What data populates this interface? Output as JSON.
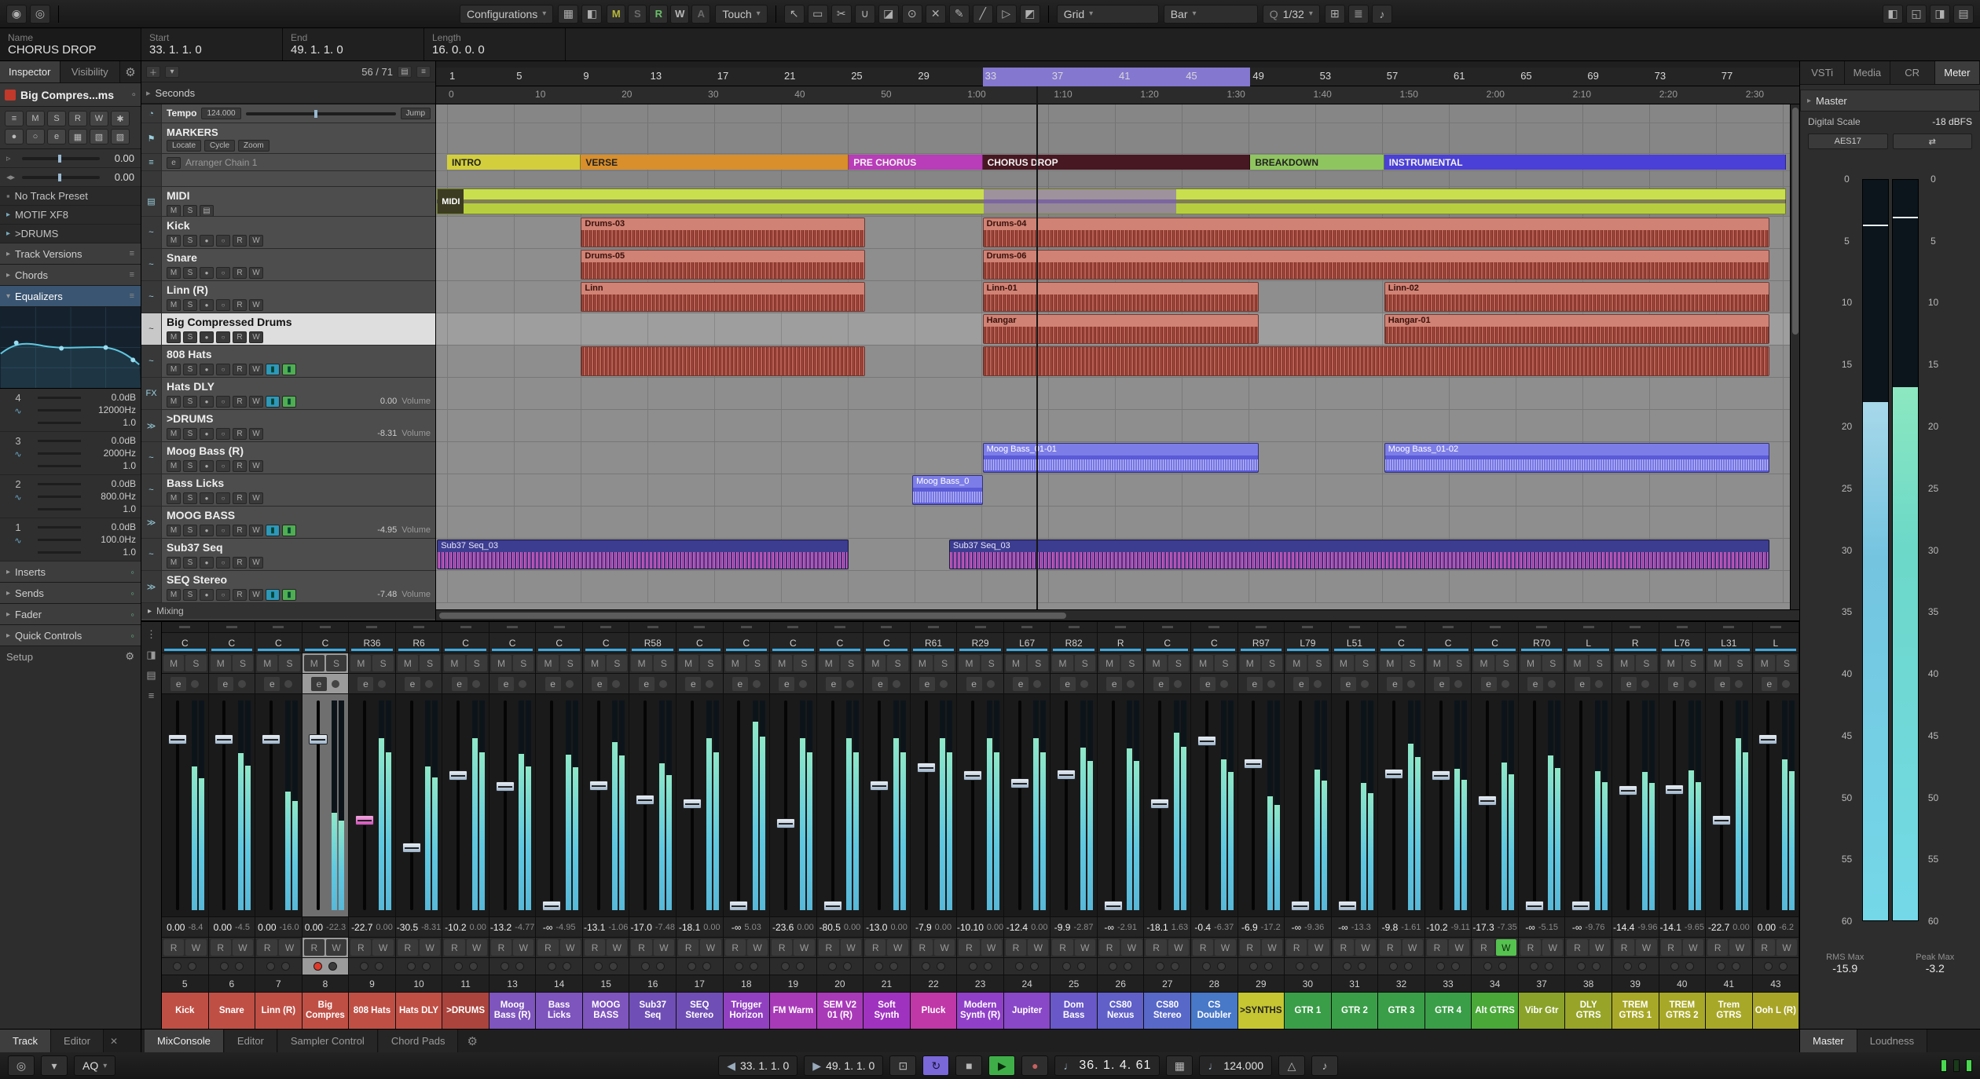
{
  "toolbar": {
    "configurations": "Configurations",
    "automation": [
      "M",
      "S",
      "R",
      "W",
      "A"
    ],
    "automation_colors": [
      "#b8b83a",
      "#6a6a6a",
      "#6abf69",
      "#b8b8b8",
      "#6a6a6a"
    ],
    "tool_mode": "Touch",
    "grid_mode": "Grid",
    "grid_type": "Bar",
    "quantize_prefix": "Q",
    "quantize": "1/32",
    "left_icons": [
      {
        "name": "activate-project-icon",
        "glyph": "◉"
      },
      {
        "name": "hub-icon",
        "glyph": "◎"
      }
    ],
    "mode_icons": [
      {
        "name": "window-layout-icon",
        "glyph": "▦"
      },
      {
        "name": "snapshot-icon",
        "glyph": "◧"
      }
    ],
    "tool_icons": [
      {
        "name": "pointer-tool-icon",
        "glyph": "↖"
      },
      {
        "name": "range-tool-icon",
        "glyph": "▭"
      },
      {
        "name": "split-tool-icon",
        "glyph": "✂"
      },
      {
        "name": "glue-tool-icon",
        "glyph": "∪"
      },
      {
        "name": "erase-tool-icon",
        "glyph": "◪"
      },
      {
        "name": "zoom-tool-icon",
        "glyph": "⊙"
      },
      {
        "name": "mute-tool-icon",
        "glyph": "✕"
      },
      {
        "name": "draw-tool-icon",
        "glyph": "✎"
      },
      {
        "name": "line-tool-icon",
        "glyph": "╱"
      },
      {
        "name": "play-tool-icon",
        "glyph": "▷"
      },
      {
        "name": "color-tool-icon",
        "glyph": "◩"
      }
    ],
    "right_icons": [
      {
        "name": "snap-icon",
        "glyph": "⊞"
      },
      {
        "name": "quantize-panel-icon",
        "glyph": "≣"
      },
      {
        "name": "midi-input-icon",
        "glyph": "♪"
      }
    ],
    "window_icons": [
      {
        "name": "left-zone-icon",
        "glyph": "◧"
      },
      {
        "name": "lower-zone-icon",
        "glyph": "◱"
      },
      {
        "name": "right-zone-icon",
        "glyph": "◨"
      },
      {
        "name": "setup-toolbar-icon",
        "glyph": "▤"
      }
    ]
  },
  "infobar": {
    "fields": [
      {
        "label": "Name",
        "value": "CHORUS DROP"
      },
      {
        "label": "Start",
        "value": "33. 1. 1. 0"
      },
      {
        "label": "End",
        "value": "49. 1. 1. 0"
      },
      {
        "label": "Length",
        "value": "16. 0. 0. 0"
      }
    ]
  },
  "inspector": {
    "tabs": [
      "Inspector",
      "Visibility"
    ],
    "track_name": "Big Compres...ms",
    "volume": "0.00",
    "pan": "0.00",
    "preset": "No Track Preset",
    "routing": [
      "MOTIF XF8",
      ">DRUMS"
    ],
    "buttons_row1": [
      "≡",
      "M",
      "S",
      "R",
      "W",
      "✱"
    ],
    "buttons_row2": [
      "●",
      "○",
      "e",
      "▦",
      "▧",
      "▨"
    ],
    "sections": [
      "Track Versions",
      "Chords",
      "Equalizers"
    ],
    "eq_bands": [
      {
        "band": "4",
        "gain": "0.0dB",
        "freq": "12000Hz",
        "q": "1.0"
      },
      {
        "band": "3",
        "gain": "0.0dB",
        "freq": "2000Hz",
        "q": "1.0"
      },
      {
        "band": "2",
        "gain": "0.0dB",
        "freq": "800.0Hz",
        "q": "1.0"
      },
      {
        "band": "1",
        "gain": "0.0dB",
        "freq": "100.0Hz",
        "q": "1.0"
      }
    ],
    "lower_sections": [
      "Inserts",
      "Sends",
      "Fader",
      "Quick Controls"
    ],
    "setup": "Setup",
    "bottom_tabs": [
      "Track",
      "Editor"
    ]
  },
  "track_list": {
    "counter": "56 / 71",
    "timebase": "Seconds",
    "tempo_track": {
      "name": "Tempo",
      "value": "124.000",
      "jump": "Jump"
    },
    "marker_track": {
      "name": "MARKERS",
      "buttons": [
        "Locate",
        "Cycle",
        "Zoom"
      ]
    },
    "arranger_track": {
      "name": "Arranger Chain 1"
    },
    "folder_track": {
      "name": "MIDI"
    },
    "mixing_label": "Mixing",
    "button_labels": {
      "mute": "M",
      "solo": "S",
      "edit": "e",
      "read": "R",
      "write": "W"
    },
    "tracks": [
      {
        "name": "Kick",
        "type": "audio"
      },
      {
        "name": "Snare",
        "type": "audio"
      },
      {
        "name": "Linn (R)",
        "type": "audio"
      },
      {
        "name": "Big Compressed Drums",
        "type": "audio",
        "selected": true
      },
      {
        "name": "808 Hats",
        "type": "audio",
        "insert_active": true
      },
      {
        "name": "Hats DLY",
        "type": "fx",
        "insert_active": true,
        "value": "0.00",
        "value_label": "Volume"
      },
      {
        "name": ">DRUMS",
        "type": "group",
        "value": "-8.31",
        "value_label": "Volume"
      },
      {
        "name": "Moog Bass (R)",
        "type": "audio"
      },
      {
        "name": "Bass Licks",
        "type": "audio"
      },
      {
        "name": "MOOG BASS",
        "type": "group",
        "insert_active": true,
        "value": "-4.95",
        "value_label": "Volume"
      },
      {
        "name": "Sub37 Seq",
        "type": "audio"
      },
      {
        "name": "SEQ Stereo",
        "type": "group",
        "insert_active": true,
        "value": "-7.48",
        "value_label": "Volume"
      }
    ]
  },
  "arrangement": {
    "ruler_bars": [
      1,
      5,
      9,
      13,
      17,
      21,
      25,
      29,
      33,
      37,
      41,
      45,
      49,
      53,
      57,
      61,
      65,
      69,
      73,
      77
    ],
    "ruler_times": [
      {
        "label": "0",
        "sec": 0
      },
      {
        "label": "10",
        "sec": 10
      },
      {
        "label": "20",
        "sec": 20
      },
      {
        "label": "30",
        "sec": 30
      },
      {
        "label": "40",
        "sec": 40
      },
      {
        "label": "50",
        "sec": 50
      },
      {
        "label": "1:00",
        "sec": 60
      },
      {
        "label": "1:10",
        "sec": 70
      },
      {
        "label": "1:20",
        "sec": 80
      },
      {
        "label": "1:30",
        "sec": 90
      },
      {
        "label": "1:40",
        "sec": 100
      },
      {
        "label": "1:50",
        "sec": 110
      },
      {
        "label": "2:00",
        "sec": 120
      },
      {
        "label": "2:10",
        "sec": 130
      },
      {
        "label": "2:20",
        "sec": 140
      },
      {
        "label": "2:30",
        "sec": 150
      }
    ],
    "cycle": {
      "start": 33,
      "end": 49
    },
    "playhead_bar": 36.2,
    "sections": [
      {
        "name": "INTRO",
        "start": 1,
        "end": 9,
        "color": "#d3cf3c",
        "dark_text": true
      },
      {
        "name": "VERSE",
        "start": 9,
        "end": 25,
        "color": "#d98f2b",
        "dark_text": true
      },
      {
        "name": "PRE CHORUS",
        "start": 25,
        "end": 33,
        "color": "#b93cb9"
      },
      {
        "name": "CHORUS DROP",
        "start": 33,
        "end": 49,
        "color": "#471722"
      },
      {
        "name": "BREAKDOWN",
        "start": 49,
        "end": 57,
        "color": "#8fc55f",
        "dark_text": true
      },
      {
        "name": "INSTRUMENTAL",
        "start": 57,
        "end": 81,
        "color": "#4a3fd6"
      }
    ],
    "folder_clip": {
      "label": "MIDI",
      "start": 0.4,
      "end": 81,
      "overlay_start": 33,
      "overlay_end": 44.5
    },
    "lanes": [
      {
        "track": "Kick",
        "clips": [
          {
            "label": "Drums-03",
            "s": 9,
            "e": 26,
            "c": "drum"
          },
          {
            "label": "Drums-04",
            "s": 33,
            "e": 80,
            "c": "drum"
          }
        ]
      },
      {
        "track": "Snare",
        "clips": [
          {
            "label": "Drums-05",
            "s": 9,
            "e": 26,
            "c": "drum"
          },
          {
            "label": "Drums-06",
            "s": 33,
            "e": 80,
            "c": "drum"
          }
        ]
      },
      {
        "track": "Linn (R)",
        "clips": [
          {
            "label": "Linn",
            "s": 9,
            "e": 26,
            "c": "drum"
          },
          {
            "label": "Linn-01",
            "s": 33,
            "e": 49.5,
            "c": "drum"
          },
          {
            "label": "Linn-02",
            "s": 57,
            "e": 80,
            "c": "drum"
          }
        ]
      },
      {
        "track": "Big Compressed Drums",
        "selected": true,
        "clips": [
          {
            "label": "Hangar",
            "s": 33,
            "e": 49.5,
            "c": "drum"
          },
          {
            "label": "Hangar-01",
            "s": 57,
            "e": 80,
            "c": "drum"
          }
        ]
      },
      {
        "track": "808 Hats",
        "clips": [
          {
            "label": "",
            "s": 9,
            "e": 26,
            "c": "drum"
          },
          {
            "label": "",
            "s": 33,
            "e": 80,
            "c": "drum"
          }
        ]
      },
      {
        "track": "Hats DLY",
        "clips": []
      },
      {
        "track": ">DRUMS",
        "clips": []
      },
      {
        "track": "Moog Bass (R)",
        "clips": [
          {
            "label": "Moog Bass_01-01",
            "s": 33,
            "e": 49.5,
            "c": "bass"
          },
          {
            "label": "Moog Bass_01-02",
            "s": 57,
            "e": 80,
            "c": "bass"
          }
        ]
      },
      {
        "track": "Bass Licks",
        "clips": [
          {
            "label": "Moog Bass_0",
            "s": 28.8,
            "e": 33,
            "c": "bass"
          }
        ]
      },
      {
        "track": "MOOG BASS",
        "clips": []
      },
      {
        "track": "Sub37 Seq",
        "clips": [
          {
            "label": "Sub37 Seq_03",
            "s": 0.4,
            "e": 25,
            "c": "seq"
          },
          {
            "label": "Sub37 Seq_03",
            "s": 31,
            "e": 80,
            "c": "seq"
          }
        ]
      },
      {
        "track": "SEQ Stereo",
        "clips": []
      }
    ]
  },
  "mixer": {
    "strip_labels": {
      "mute": "M",
      "solo": "S",
      "edit": "e",
      "read": "R",
      "write": "W"
    },
    "tool_icons": [
      {
        "name": "mixer-menu-icon",
        "glyph": "⋮"
      },
      {
        "name": "mixer-zones-icon",
        "glyph": "◨"
      },
      {
        "name": "mixer-racks-icon",
        "glyph": "▤"
      },
      {
        "name": "mixer-link-icon",
        "glyph": "≡"
      }
    ],
    "channels": [
      {
        "num": 5,
        "name": "Kick",
        "pan": "C",
        "db": "0.00",
        "peak": "-8.4",
        "color": "#bf4f45"
      },
      {
        "num": 6,
        "name": "Snare",
        "pan": "C",
        "db": "0.00",
        "peak": "-4.5",
        "color": "#bf4f45"
      },
      {
        "num": 7,
        "name": "Linn (R)",
        "pan": "C",
        "db": "0.00",
        "peak": "-16.0",
        "color": "#bf4f45"
      },
      {
        "num": 8,
        "name": "Big Compres",
        "pan": "C",
        "db": "0.00",
        "peak": "-22.3",
        "color": "#bf4f45",
        "selected": true,
        "record": true
      },
      {
        "num": 9,
        "name": "808 Hats",
        "pan": "R36",
        "db": "-22.7",
        "peak": "0.00",
        "color": "#bf4f45",
        "cap": "pink"
      },
      {
        "num": 10,
        "name": "Hats DLY",
        "pan": "R6",
        "db": "-30.5",
        "peak": "-8.31",
        "color": "#bf4f45"
      },
      {
        "num": 11,
        "name": ">DRUMS",
        "pan": "C",
        "db": "-10.2",
        "peak": "0.00",
        "color": "#ab443c"
      },
      {
        "num": 13,
        "name": "Moog Bass (R)",
        "pan": "C",
        "db": "-13.2",
        "peak": "-4.77",
        "color": "#7e54bd"
      },
      {
        "num": 14,
        "name": "Bass Licks",
        "pan": "C",
        "db": "-∞",
        "peak": "-4.95",
        "color": "#7e54bd"
      },
      {
        "num": 15,
        "name": "MOOG BASS",
        "pan": "C",
        "db": "-13.1",
        "peak": "-1.06",
        "color": "#7e54bd"
      },
      {
        "num": 16,
        "name": "Sub37 Seq",
        "pan": "R58",
        "db": "-17.0",
        "peak": "-7.48",
        "color": "#6f4fb5"
      },
      {
        "num": 17,
        "name": "SEQ Stereo",
        "pan": "C",
        "db": "-18.1",
        "peak": "0.00",
        "color": "#6f4fb5"
      },
      {
        "num": 18,
        "name": "Trigger Horizon",
        "pan": "C",
        "db": "-∞",
        "peak": "5.03",
        "color": "#9140c0"
      },
      {
        "num": 19,
        "name": "FM Warm",
        "pan": "C",
        "db": "-23.6",
        "peak": "0.00",
        "color": "#a83ab8"
      },
      {
        "num": 20,
        "name": "SEM V2 01 (R)",
        "pan": "C",
        "db": "-80.5",
        "peak": "0.00",
        "color": "#a83ab8"
      },
      {
        "num": 21,
        "name": "Soft Synth",
        "pan": "C",
        "db": "-13.0",
        "peak": "0.00",
        "color": "#a032c0"
      },
      {
        "num": 22,
        "name": "Pluck",
        "pan": "R61",
        "db": "-7.9",
        "peak": "0.00",
        "color": "#c038a8"
      },
      {
        "num": 23,
        "name": "Modern Synth (R)",
        "pan": "R29",
        "db": "-10.10",
        "peak": "0.00",
        "color": "#9040c8"
      },
      {
        "num": 24,
        "name": "Jupiter",
        "pan": "L67",
        "db": "-12.4",
        "peak": "0.00",
        "color": "#8848c8"
      },
      {
        "num": 25,
        "name": "Dom Bass",
        "pan": "R82",
        "db": "-9.9",
        "peak": "-2.87",
        "color": "#6858c8"
      },
      {
        "num": 26,
        "name": "CS80 Nexus",
        "pan": "R",
        "db": "-∞",
        "peak": "-2.91",
        "color": "#6060c8"
      },
      {
        "num": 27,
        "name": "CS80 Stereo",
        "pan": "C",
        "db": "-18.1",
        "peak": "1.63",
        "color": "#5868c8"
      },
      {
        "num": 28,
        "name": "CS Doubler",
        "pan": "C",
        "db": "-0.4",
        "peak": "-6.37",
        "color": "#4878c8"
      },
      {
        "num": 29,
        "name": ">SYNTHS",
        "pan": "R97",
        "db": "-6.9",
        "peak": "-17.2",
        "color": "#c6c632",
        "dark_name": true
      },
      {
        "num": 30,
        "name": "GTR 1",
        "pan": "L79",
        "db": "-∞",
        "peak": "-9.36",
        "color": "#3a9e48"
      },
      {
        "num": 31,
        "name": "GTR 2",
        "pan": "L51",
        "db": "-∞",
        "peak": "-13.3",
        "color": "#3a9e48"
      },
      {
        "num": 32,
        "name": "GTR 3",
        "pan": "C",
        "db": "-9.8",
        "peak": "-1.61",
        "color": "#3a9e48"
      },
      {
        "num": 33,
        "name": "GTR 4",
        "pan": "C",
        "db": "-10.2",
        "peak": "-9.11",
        "color": "#3a9e48"
      },
      {
        "num": 34,
        "name": "Alt GTRS",
        "pan": "C",
        "db": "-17.3",
        "peak": "-7.35",
        "color": "#49a838",
        "write": true
      },
      {
        "num": 37,
        "name": "Vibr Gtr",
        "pan": "R70",
        "db": "-∞",
        "peak": "-5.15",
        "color": "#8aa22a"
      },
      {
        "num": 38,
        "name": "DLY GTRS",
        "pan": "L",
        "db": "-∞",
        "peak": "-9.76",
        "color": "#97a428"
      },
      {
        "num": 39,
        "name": "TREM GTRS 1",
        "pan": "R",
        "db": "-14.4",
        "peak": "-9.96",
        "color": "#a8a828"
      },
      {
        "num": 40,
        "name": "TREM GTRS 2",
        "pan": "L76",
        "db": "-14.1",
        "peak": "-9.65",
        "color": "#a8a828"
      },
      {
        "num": 41,
        "name": "Trem GTRS",
        "pan": "L31",
        "db": "-22.7",
        "peak": "0.00",
        "color": "#a8a828"
      },
      {
        "num": 43,
        "name": "Ooh L (R)",
        "pan": "L",
        "db": "0.00",
        "peak": "-6.2",
        "color": "#a8a428"
      }
    ]
  },
  "meter_panel": {
    "tabs": [
      "VSTi",
      "Media",
      "CR",
      "Meter"
    ],
    "active_tab": "Meter",
    "master": "Master",
    "scale_label": "Digital Scale",
    "scale_value": "-18 dBFS",
    "standard": "AES17",
    "standard_icon": "⇄",
    "ticks": [
      0,
      5,
      10,
      15,
      20,
      25,
      30,
      35,
      40,
      45,
      50,
      55,
      60
    ],
    "bar_fills": [
      0.7,
      0.72
    ],
    "rms_label": "RMS Max",
    "rms_value": "-15.9",
    "peak_label": "Peak Max",
    "peak_value": "-3.2"
  },
  "bottom_bar": {
    "left_tabs": [
      "Track",
      "Editor"
    ],
    "left_active": "Track",
    "tabs": [
      "MixConsole",
      "Editor",
      "Sampler Control",
      "Chord Pads"
    ],
    "active_tab": "MixConsole",
    "right_tabs": [
      "Master",
      "Loudness"
    ],
    "right_active": "Master"
  },
  "transport": {
    "aq": "AQ",
    "left_locator": "33. 1. 1. 0",
    "right_locator": "49. 1. 1. 0",
    "position": "36. 1. 4. 61",
    "tempo": "124.000",
    "icons": {
      "punch": "◎",
      "note": "♩",
      "cycle": "↻",
      "stop": "■",
      "play": "▶",
      "record": "●",
      "prev": "◀",
      "next": "▶",
      "lock": "⊡",
      "metronome": "△",
      "sync": "♪",
      "keypad": "▦"
    }
  }
}
